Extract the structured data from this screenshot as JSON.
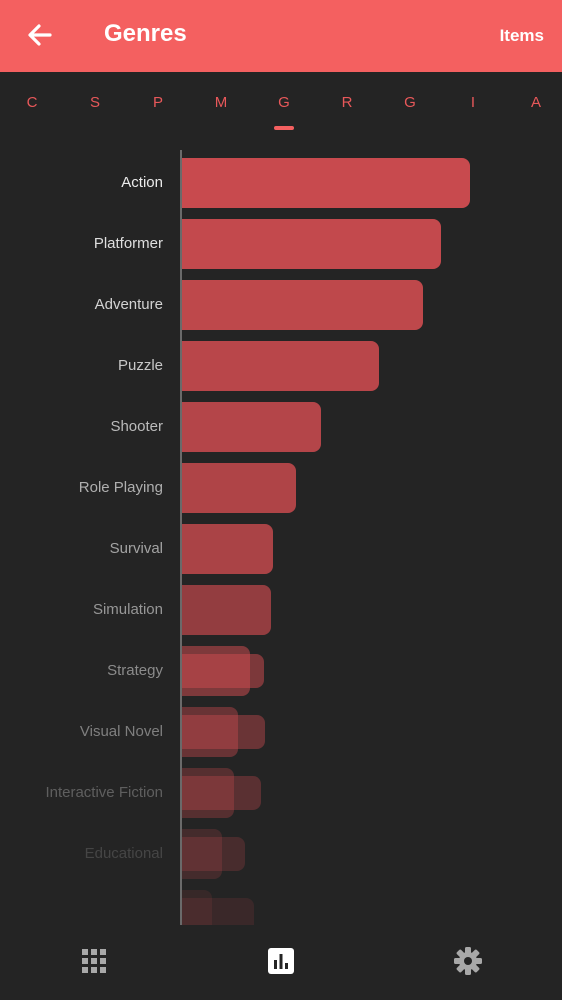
{
  "header": {
    "title": "Genres",
    "items_label": "Items",
    "color": "#f46060"
  },
  "tabs": [
    {
      "label": "C"
    },
    {
      "label": "S"
    },
    {
      "label": "P"
    },
    {
      "label": "M"
    },
    {
      "label": "G",
      "selected": true
    },
    {
      "label": "R"
    },
    {
      "label": "G"
    },
    {
      "label": "I"
    },
    {
      "label": "A"
    }
  ],
  "chart_data": {
    "type": "bar",
    "orientation": "horizontal",
    "categories": [
      "Action",
      "Platformer",
      "Adventure",
      "Puzzle",
      "Shooter",
      "Role Playing",
      "Survival",
      "Simulation",
      "Strategy",
      "Visual Novel",
      "Interactive Fiction",
      "Educational",
      ""
    ],
    "values": [
      288,
      259,
      241,
      197,
      139,
      114,
      91,
      89,
      68,
      56,
      52,
      40,
      30
    ],
    "secondary_values": [
      0,
      0,
      0,
      0,
      0,
      0,
      0,
      0,
      82,
      83,
      79,
      63,
      72
    ],
    "bar_color": "#c84a4e"
  },
  "bottom_nav": [
    {
      "icon": "grid-icon"
    },
    {
      "icon": "bar-chart-icon",
      "selected": true
    },
    {
      "icon": "gear-icon"
    }
  ]
}
